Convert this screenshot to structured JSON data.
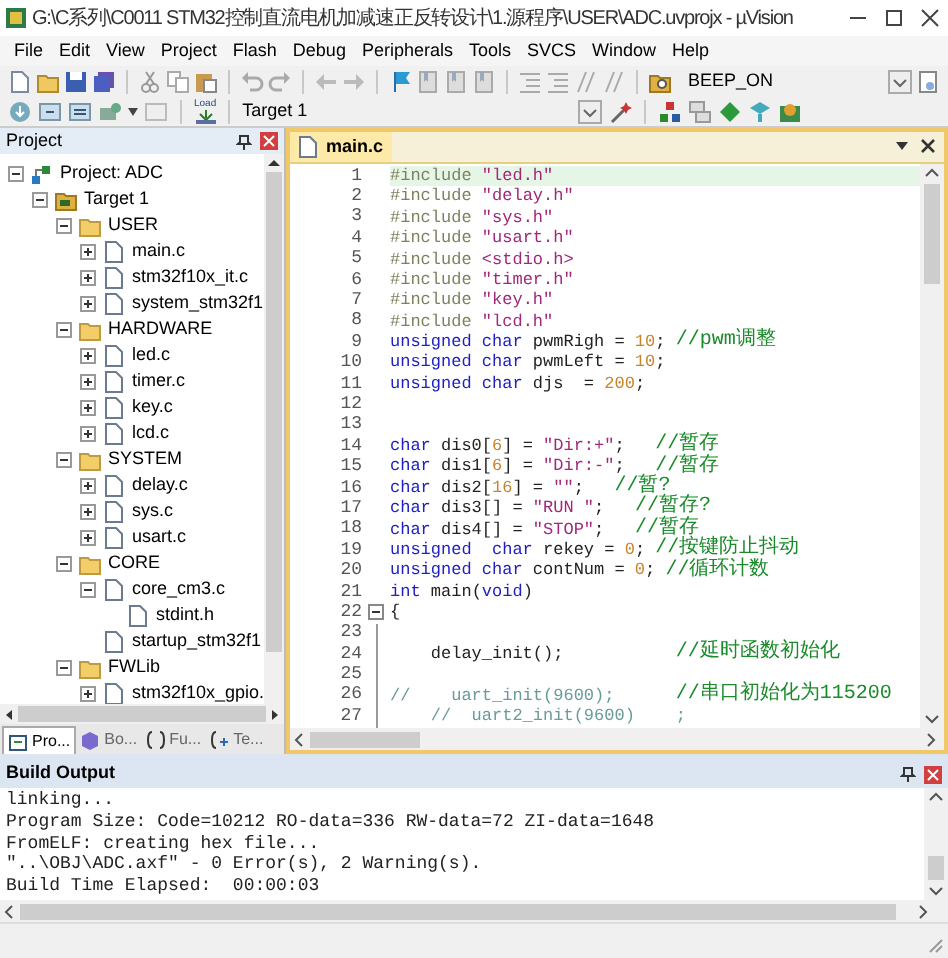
{
  "window": {
    "title": "G:\\C系列\\C0011 STM32控制直流电机加减速正反转设计\\1.源程序\\USER\\ADC.uvprojx - µVision"
  },
  "menu": [
    "File",
    "Edit",
    "View",
    "Project",
    "Flash",
    "Debug",
    "Peripherals",
    "Tools",
    "SVCS",
    "Window",
    "Help"
  ],
  "toolbar": {
    "find_text": "BEEP_ON"
  },
  "build_toolbar": {
    "load_label": "Load",
    "target": "Target 1"
  },
  "project_panel": {
    "title": "Project",
    "tree": [
      {
        "label": "Project: ADC",
        "kind": "project",
        "expanded": true,
        "children": [
          {
            "label": "Target 1",
            "kind": "target",
            "expanded": true,
            "children": [
              {
                "label": "USER",
                "kind": "group",
                "expanded": true,
                "children": [
                  {
                    "label": "main.c",
                    "kind": "file",
                    "expanded": false
                  },
                  {
                    "label": "stm32f10x_it.c",
                    "kind": "file",
                    "expanded": false
                  },
                  {
                    "label": "system_stm32f1",
                    "kind": "file",
                    "expanded": false
                  }
                ]
              },
              {
                "label": "HARDWARE",
                "kind": "group",
                "expanded": true,
                "children": [
                  {
                    "label": "led.c",
                    "kind": "file",
                    "expanded": false
                  },
                  {
                    "label": "timer.c",
                    "kind": "file",
                    "expanded": false
                  },
                  {
                    "label": "key.c",
                    "kind": "file",
                    "expanded": false
                  },
                  {
                    "label": "lcd.c",
                    "kind": "file",
                    "expanded": false
                  }
                ]
              },
              {
                "label": "SYSTEM",
                "kind": "group",
                "expanded": true,
                "children": [
                  {
                    "label": "delay.c",
                    "kind": "file",
                    "expanded": false
                  },
                  {
                    "label": "sys.c",
                    "kind": "file",
                    "expanded": false
                  },
                  {
                    "label": "usart.c",
                    "kind": "file",
                    "expanded": false
                  }
                ]
              },
              {
                "label": "CORE",
                "kind": "group",
                "expanded": true,
                "children": [
                  {
                    "label": "core_cm3.c",
                    "kind": "file",
                    "expanded": true,
                    "children": [
                      {
                        "label": "stdint.h",
                        "kind": "file"
                      }
                    ]
                  },
                  {
                    "label": "startup_stm32f1",
                    "kind": "file"
                  }
                ]
              },
              {
                "label": "FWLib",
                "kind": "group",
                "expanded": true,
                "children": [
                  {
                    "label": "stm32f10x_gpio.",
                    "kind": "file",
                    "expanded": false
                  }
                ]
              }
            ]
          }
        ]
      }
    ],
    "tabs": [
      {
        "label": "Pro...",
        "kind": "project",
        "selected": true
      },
      {
        "label": "Bo...",
        "kind": "books",
        "selected": false
      },
      {
        "label": "Fu...",
        "kind": "functions",
        "selected": false
      },
      {
        "label": "Te...",
        "kind": "templates",
        "selected": false
      }
    ]
  },
  "editor": {
    "tabs": [
      {
        "label": "main.c",
        "selected": true
      }
    ],
    "lines": [
      {
        "number": "1",
        "highlighted": true,
        "tokens": [
          {
            "kind": "preprocessor",
            "text": "#include "
          },
          {
            "kind": "string",
            "text": "\"led.h\""
          }
        ]
      },
      {
        "number": "2",
        "highlighted": false,
        "tokens": [
          {
            "kind": "preprocessor",
            "text": "#include "
          },
          {
            "kind": "string",
            "text": "\"delay.h\""
          }
        ]
      },
      {
        "number": "3",
        "highlighted": false,
        "tokens": [
          {
            "kind": "preprocessor",
            "text": "#include "
          },
          {
            "kind": "string",
            "text": "\"sys.h\""
          }
        ]
      },
      {
        "number": "4",
        "highlighted": false,
        "tokens": [
          {
            "kind": "preprocessor",
            "text": "#include "
          },
          {
            "kind": "string",
            "text": "\"usart.h\""
          }
        ]
      },
      {
        "number": "5",
        "highlighted": false,
        "tokens": [
          {
            "kind": "preprocessor",
            "text": "#include "
          },
          {
            "kind": "string",
            "text": "<stdio.h>"
          }
        ]
      },
      {
        "number": "6",
        "highlighted": false,
        "tokens": [
          {
            "kind": "preprocessor",
            "text": "#include "
          },
          {
            "kind": "string",
            "text": "\"timer.h\""
          }
        ]
      },
      {
        "number": "7",
        "highlighted": false,
        "tokens": [
          {
            "kind": "preprocessor",
            "text": "#include "
          },
          {
            "kind": "string",
            "text": "\"key.h\""
          }
        ]
      },
      {
        "number": "8",
        "highlighted": false,
        "tokens": [
          {
            "kind": "preprocessor",
            "text": "#include "
          },
          {
            "kind": "string",
            "text": "\"lcd.h\""
          }
        ]
      },
      {
        "number": "9",
        "highlighted": false,
        "tokens": [
          {
            "kind": "keyword",
            "text": "unsigned char"
          },
          {
            "kind": "plain",
            "text": " pwmRigh = "
          },
          {
            "kind": "number",
            "text": "10"
          },
          {
            "kind": "plain",
            "text": "; "
          },
          {
            "kind": "comment",
            "text": "//pwm调整"
          }
        ]
      },
      {
        "number": "10",
        "highlighted": false,
        "tokens": [
          {
            "kind": "keyword",
            "text": "unsigned char"
          },
          {
            "kind": "plain",
            "text": " pwmLeft = "
          },
          {
            "kind": "number",
            "text": "10"
          },
          {
            "kind": "plain",
            "text": ";"
          }
        ]
      },
      {
        "number": "11",
        "highlighted": false,
        "tokens": [
          {
            "kind": "keyword",
            "text": "unsigned char"
          },
          {
            "kind": "plain",
            "text": " djs  = "
          },
          {
            "kind": "number",
            "text": "200"
          },
          {
            "kind": "plain",
            "text": ";"
          }
        ]
      },
      {
        "number": "12",
        "highlighted": false
      },
      {
        "number": "13",
        "highlighted": false
      },
      {
        "number": "14",
        "highlighted": false,
        "tokens": [
          {
            "kind": "keyword",
            "text": "char"
          },
          {
            "kind": "plain",
            "text": " dis0["
          },
          {
            "kind": "number",
            "text": "6"
          },
          {
            "kind": "plain",
            "text": "] = "
          },
          {
            "kind": "string",
            "text": "\"Dir:+\""
          },
          {
            "kind": "plain",
            "text": ";   "
          },
          {
            "kind": "comment",
            "text": "//暂存"
          }
        ]
      },
      {
        "number": "15",
        "highlighted": false,
        "tokens": [
          {
            "kind": "keyword",
            "text": "char"
          },
          {
            "kind": "plain",
            "text": " dis1["
          },
          {
            "kind": "number",
            "text": "6"
          },
          {
            "kind": "plain",
            "text": "] = "
          },
          {
            "kind": "string",
            "text": "\"Dir:-\""
          },
          {
            "kind": "plain",
            "text": ";   "
          },
          {
            "kind": "comment",
            "text": "//暂存"
          }
        ]
      },
      {
        "number": "16",
        "highlighted": false,
        "tokens": [
          {
            "kind": "keyword",
            "text": "char"
          },
          {
            "kind": "plain",
            "text": " dis2["
          },
          {
            "kind": "number",
            "text": "16"
          },
          {
            "kind": "plain",
            "text": "] = "
          },
          {
            "kind": "string",
            "text": "\"\""
          },
          {
            "kind": "plain",
            "text": ";   "
          },
          {
            "kind": "comment",
            "text": "//暂?"
          }
        ]
      },
      {
        "number": "17",
        "highlighted": false,
        "tokens": [
          {
            "kind": "keyword",
            "text": "char"
          },
          {
            "kind": "plain",
            "text": " dis3[] = "
          },
          {
            "kind": "string",
            "text": "\"RUN \""
          },
          {
            "kind": "plain",
            "text": ";   "
          },
          {
            "kind": "comment",
            "text": "//暂存?"
          }
        ]
      },
      {
        "number": "18",
        "highlighted": false,
        "tokens": [
          {
            "kind": "keyword",
            "text": "char"
          },
          {
            "kind": "plain",
            "text": " dis4[] = "
          },
          {
            "kind": "string",
            "text": "\"STOP\""
          },
          {
            "kind": "plain",
            "text": ";   "
          },
          {
            "kind": "comment",
            "text": "//暂存"
          }
        ]
      },
      {
        "number": "19",
        "highlighted": false,
        "tokens": [
          {
            "kind": "keyword",
            "text": "unsigned  char"
          },
          {
            "kind": "plain",
            "text": " rekey = "
          },
          {
            "kind": "number",
            "text": "0"
          },
          {
            "kind": "plain",
            "text": "; "
          },
          {
            "kind": "comment",
            "text": "//按键防止抖动"
          }
        ]
      },
      {
        "number": "20",
        "highlighted": false,
        "tokens": [
          {
            "kind": "keyword",
            "text": "unsigned char"
          },
          {
            "kind": "plain",
            "text": " contNum = "
          },
          {
            "kind": "number",
            "text": "0"
          },
          {
            "kind": "plain",
            "text": "; "
          },
          {
            "kind": "comment",
            "text": "//循环计数"
          }
        ]
      },
      {
        "number": "21",
        "highlighted": false,
        "tokens": [
          {
            "kind": "keyword",
            "text": "int"
          },
          {
            "kind": "plain",
            "text": " main("
          },
          {
            "kind": "keyword",
            "text": "void"
          },
          {
            "kind": "plain",
            "text": ")"
          }
        ]
      },
      {
        "number": "22",
        "highlighted": false,
        "kind": "fold_start",
        "tokens": [
          {
            "kind": "plain",
            "text": "{"
          }
        ]
      },
      {
        "number": "23",
        "highlighted": false,
        "kind": "fold_body"
      },
      {
        "number": "24",
        "highlighted": false,
        "kind": "fold_body",
        "tokens": [
          {
            "kind": "plain",
            "text": "    delay_init();           "
          },
          {
            "kind": "comment",
            "text": "//延时函数初始化"
          }
        ]
      },
      {
        "number": "25",
        "highlighted": false,
        "kind": "fold_body"
      },
      {
        "number": "26",
        "highlighted": false,
        "kind": "fold_body",
        "tokens": [
          {
            "kind": "disabled",
            "text": "//    uart_init(9600);      "
          },
          {
            "kind": "comment",
            "text": "//串口初始化为115200"
          }
        ]
      },
      {
        "number": "27",
        "highlighted": false,
        "kind": "fold_body",
        "tokens": [
          {
            "kind": "disabled",
            "text": "    //  uart2_init(9600)    ;"
          }
        ]
      }
    ]
  },
  "build_output": {
    "title": "Build Output",
    "lines": [
      "linking...",
      "Program Size: Code=10212 RO-data=336 RW-data=72 ZI-data=1648",
      "FromELF: creating hex file...",
      "\"..\\OBJ\\ADC.axf\" - 0 Error(s), 2 Warning(s).",
      "Build Time Elapsed:  00:00:03"
    ]
  }
}
